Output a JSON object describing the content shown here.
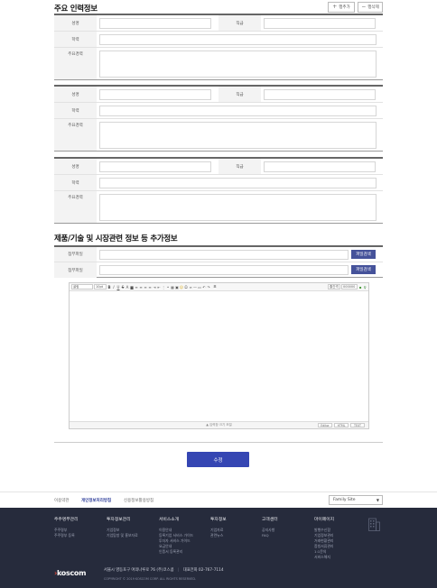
{
  "section_personnel": {
    "title": "주요 인력정보",
    "add_label": "행추가",
    "delete_label": "행삭제"
  },
  "personnel_labels": {
    "name": "성명",
    "position": "직급",
    "education": "학력",
    "career": "주요경력"
  },
  "section_extra": {
    "title": "제품/기술 및 시장관련 정보 등 추가정보",
    "attachment_label": "첨부파일",
    "file_search_label": "파일검색"
  },
  "editor": {
    "font_select": "굴림",
    "size_select": "10pt",
    "line_height_select": "줄간격",
    "text_color": "000000",
    "extra_label": "표",
    "resize_hint": "▲ 입력창 크기 조절",
    "tab_editor": "Editor",
    "tab_html": "HTML",
    "tab_text": "TEXT"
  },
  "submit_label": "수정",
  "footer_links": {
    "terms": "이용약관",
    "privacy": "개인정보처리방침",
    "credit": "신용정보활용방침",
    "family_site": "Family Site"
  },
  "footer_menu": [
    {
      "title": "주주명부관리",
      "items": [
        "주주명부",
        "주주명부 등록"
      ]
    },
    {
      "title": "투자정보관리",
      "items": [
        "기업정보",
        "기업탐방 및 홍보자료"
      ]
    },
    {
      "title": "서비스소개",
      "items": [
        "이용안내",
        "등록기업 서비스 가이드",
        "투자자 서비스 가이드",
        "요금안내",
        "인증서 등록관리"
      ]
    },
    {
      "title": "투자정보",
      "items": [
        "기업자료",
        "관련뉴스"
      ]
    },
    {
      "title": "고객센터",
      "items": [
        "공지사항",
        "FAQ"
      ]
    },
    {
      "title": "마이페이지",
      "items": [
        "발행수신함",
        "기업정보관리",
        "거래현황관리",
        "증빙서류관리",
        "1:1문의",
        "서비스해지"
      ]
    }
  ],
  "company": {
    "logo": "koscom",
    "address": "서울시 영등포구 여의나루로 76 (주)코스콤",
    "phone": "대표전화 02-767-7114",
    "copyright": "COPYRIGHT © 2019 KOSCOM CORP. ALL RIGHTS RESERVED."
  },
  "colors": {
    "accent": "#3546b3",
    "file_button": "#45529a",
    "footer_bg": "#262b3c"
  }
}
